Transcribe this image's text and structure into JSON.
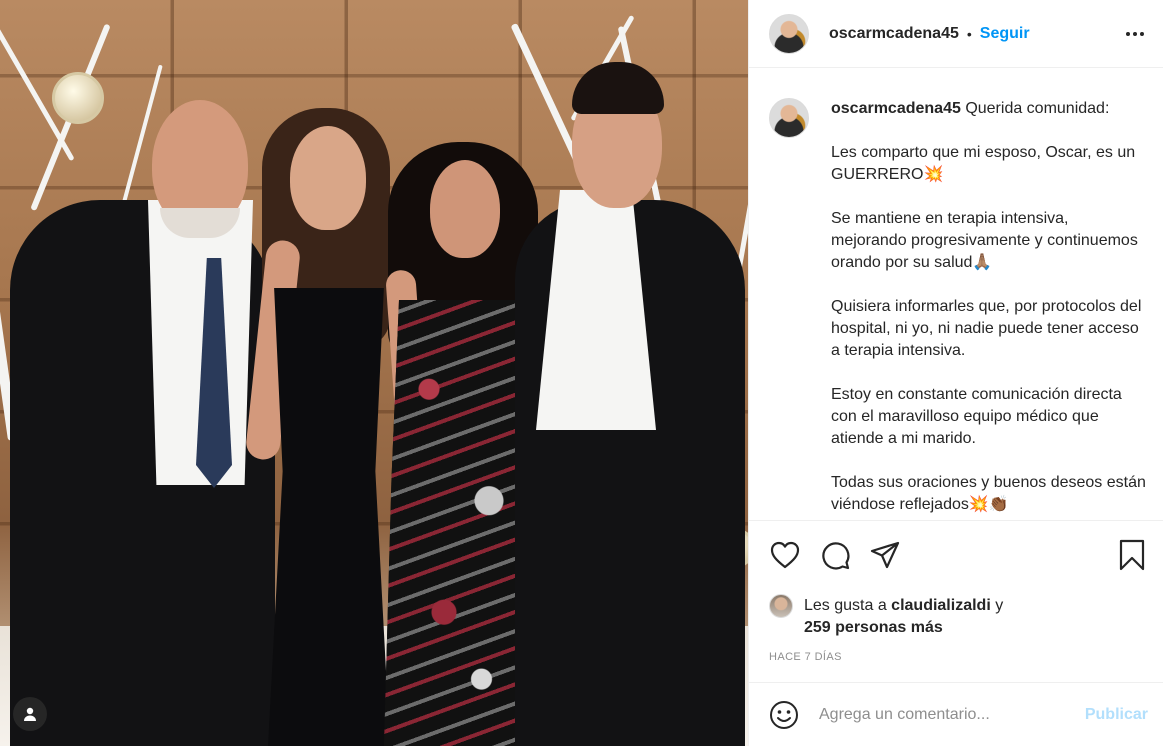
{
  "post": {
    "username": "oscarmcadena45",
    "follow_label": "Seguir",
    "separator": "•"
  },
  "caption": {
    "username": "oscarmcadena45",
    "paragraphs": [
      "Querida comunidad:",
      "Les comparto que mi esposo, Oscar, es un GUERRERO💥",
      "Se mantiene en terapia intensiva, mejorando progresivamente y continuemos orando por su salud🙏🏽",
      "Quisiera informarles que, por protocolos del hospital, ni yo, ni nadie puede tener acceso a terapia intensiva.",
      "Estoy en constante comunicación directa con el maravilloso equipo médico que atiende a mi marido.",
      "Todas sus oraciones y buenos deseos están viéndose reflejados💥👏🏾"
    ]
  },
  "likes": {
    "prefix": "Les gusta a ",
    "user": "claudializaldi",
    "connector": " y",
    "others": "259 personas más"
  },
  "timestamp": "HACE 7 DÍAS",
  "comment": {
    "placeholder": "Agrega un comentario...",
    "publish_label": "Publicar"
  },
  "icons": {
    "like": "heart-icon",
    "comment": "comment-icon",
    "share": "share-icon",
    "save": "bookmark-icon",
    "more": "more-options-icon",
    "emoji": "emoji-icon",
    "user_tag": "user-tag-icon"
  },
  "colors": {
    "link_blue": "#0095f6",
    "publish_disabled": "#b2dffc",
    "secondary_text": "#8e8e8e",
    "border": "#efefef"
  }
}
